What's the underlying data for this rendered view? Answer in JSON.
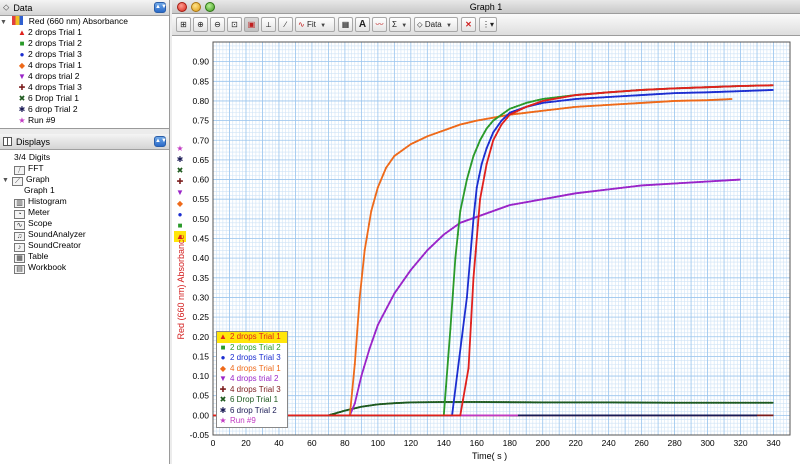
{
  "left_panel": {
    "data_header": "Data",
    "data_root": "Red (660 nm) Absorbance",
    "runs": [
      {
        "label": "2 drops Trial 1",
        "marker": "▲",
        "color": "#e0211d"
      },
      {
        "label": "2 drops Trial 2",
        "marker": "■",
        "color": "#2a9a2a"
      },
      {
        "label": "2 drops Trial 3",
        "marker": "●",
        "color": "#1c2ed0"
      },
      {
        "label": "4 drops Trial 1",
        "marker": "◆",
        "color": "#ee6a1a"
      },
      {
        "label": "4 drops trial 2",
        "marker": "▼",
        "color": "#9a25c8"
      },
      {
        "label": "4 drops Trial 3",
        "marker": "✚",
        "color": "#7a1b1b"
      },
      {
        "label": "6 Drop Trial 1",
        "marker": "✖",
        "color": "#1f5a1f"
      },
      {
        "label": "6 drop Trial 2",
        "marker": "✱",
        "color": "#1a1a55"
      },
      {
        "label": "Run #9",
        "marker": "★",
        "color": "#c23ac2"
      }
    ],
    "displays_header": "Displays",
    "display_items": [
      {
        "label": "Digits",
        "icon": "digits-icon",
        "glyph": "3/4",
        "indent": 0
      },
      {
        "label": "FFT",
        "icon": "fft-icon",
        "glyph": "",
        "indent": 0
      },
      {
        "label": "Graph",
        "icon": "graph-icon",
        "glyph": "",
        "indent": 0
      },
      {
        "label": "Graph 1",
        "icon": "",
        "glyph": "",
        "indent": 1
      },
      {
        "label": "Histogram",
        "icon": "histogram-icon",
        "glyph": "",
        "indent": 0
      },
      {
        "label": "Meter",
        "icon": "meter-icon",
        "glyph": "",
        "indent": 0
      },
      {
        "label": "Scope",
        "icon": "scope-icon",
        "glyph": "",
        "indent": 0
      },
      {
        "label": "SoundAnalyzer",
        "icon": "sound-analyzer-icon",
        "glyph": "",
        "indent": 0
      },
      {
        "label": "SoundCreator",
        "icon": "sound-creator-icon",
        "glyph": "",
        "indent": 0
      },
      {
        "label": "Table",
        "icon": "table-icon",
        "glyph": "",
        "indent": 0
      },
      {
        "label": "Workbook",
        "icon": "workbook-icon",
        "glyph": "",
        "indent": 0
      }
    ]
  },
  "window": {
    "title": "Graph 1",
    "toolbar": {
      "fit_label": "Fit",
      "data_label": "Data",
      "sigma_label": "Σ",
      "letter_a": "A"
    }
  },
  "chart_data": {
    "type": "line",
    "title": "",
    "xlabel": "Time( s )",
    "ylabel": "Red (660 nm) Absorbance",
    "xlim": [
      0,
      350
    ],
    "ylim": [
      -0.05,
      0.95
    ],
    "x_ticks": [
      0,
      10,
      20,
      30,
      40,
      50,
      60,
      70,
      80,
      90,
      100,
      110,
      120,
      130,
      140,
      150,
      160,
      170,
      180,
      190,
      200,
      210,
      220,
      230,
      240,
      250,
      260,
      270,
      280,
      290,
      300,
      310,
      320,
      330,
      340
    ],
    "y_ticks": [
      -0.05,
      0.0,
      0.05,
      0.1,
      0.15,
      0.2,
      0.25,
      0.3,
      0.35,
      0.4,
      0.45,
      0.5,
      0.55,
      0.6,
      0.65,
      0.7,
      0.75,
      0.8,
      0.85,
      0.9
    ],
    "grid": true,
    "legend_position": "bottom-left",
    "series": [
      {
        "name": "2 drops Trial 1",
        "color": "#e0211d",
        "marker": "▲",
        "x": [
          0,
          150,
          155,
          158,
          162,
          166,
          170,
          175,
          180,
          190,
          200,
          220,
          240,
          260,
          280,
          300,
          320,
          340
        ],
        "y": [
          0,
          0,
          0.12,
          0.35,
          0.55,
          0.64,
          0.7,
          0.74,
          0.765,
          0.785,
          0.8,
          0.815,
          0.822,
          0.828,
          0.832,
          0.835,
          0.838,
          0.84
        ]
      },
      {
        "name": "2 drops Trial 2",
        "color": "#2a9a2a",
        "marker": "■",
        "x": [
          0,
          140,
          144,
          147,
          150,
          154,
          158,
          162,
          166,
          170,
          175,
          180,
          190,
          200,
          220,
          240,
          260,
          280,
          300,
          320,
          340
        ],
        "y": [
          0,
          0,
          0.22,
          0.4,
          0.52,
          0.6,
          0.66,
          0.7,
          0.73,
          0.75,
          0.765,
          0.78,
          0.795,
          0.805,
          0.815,
          0.822,
          0.828,
          0.832,
          0.835,
          0.838,
          0.84
        ]
      },
      {
        "name": "2 drops Trial 3",
        "color": "#1c2ed0",
        "marker": "●",
        "x": [
          0,
          145,
          148,
          151,
          154,
          156,
          158,
          160,
          163,
          166,
          170,
          175,
          180,
          190,
          200,
          220,
          240,
          260,
          280,
          300,
          320,
          340
        ],
        "y": [
          0,
          0,
          0.1,
          0.2,
          0.3,
          0.4,
          0.5,
          0.58,
          0.64,
          0.68,
          0.72,
          0.75,
          0.77,
          0.785,
          0.795,
          0.805,
          0.81,
          0.815,
          0.82,
          0.822,
          0.825,
          0.828
        ]
      },
      {
        "name": "4 drops Trial 1",
        "color": "#ee6a1a",
        "marker": "◆",
        "x": [
          0,
          83,
          86,
          89,
          92,
          96,
          100,
          105,
          110,
          120,
          130,
          140,
          150,
          160,
          180,
          200,
          220,
          240,
          260,
          280,
          300,
          315
        ],
        "y": [
          0,
          0,
          0.13,
          0.3,
          0.42,
          0.52,
          0.58,
          0.63,
          0.66,
          0.69,
          0.71,
          0.725,
          0.74,
          0.75,
          0.765,
          0.775,
          0.785,
          0.79,
          0.795,
          0.8,
          0.802,
          0.805
        ]
      },
      {
        "name": "4 drops trial 2",
        "color": "#9a25c8",
        "marker": "▼",
        "x": [
          0,
          83,
          86,
          90,
          95,
          100,
          110,
          120,
          130,
          140,
          150,
          160,
          170,
          180,
          200,
          220,
          240,
          260,
          280,
          300,
          320
        ],
        "y": [
          0,
          0,
          0.03,
          0.1,
          0.17,
          0.23,
          0.31,
          0.37,
          0.42,
          0.46,
          0.49,
          0.505,
          0.52,
          0.535,
          0.55,
          0.565,
          0.575,
          0.585,
          0.59,
          0.595,
          0.6
        ]
      },
      {
        "name": "4 drops Trial 3",
        "color": "#7a1b1b",
        "marker": "✚",
        "x": [
          0,
          340
        ],
        "y": [
          0,
          0
        ]
      },
      {
        "name": "6 Drop Trial 1",
        "color": "#1f5a1f",
        "marker": "✖",
        "x": [
          0,
          70,
          80,
          90,
          100,
          110,
          120,
          140,
          160,
          200,
          240,
          280,
          320,
          340
        ],
        "y": [
          0,
          0,
          0.012,
          0.022,
          0.028,
          0.031,
          0.033,
          0.034,
          0.034,
          0.033,
          0.033,
          0.032,
          0.032,
          0.032
        ]
      },
      {
        "name": "6 drop Trial 2",
        "color": "#1a1a55",
        "marker": "✱",
        "x": [
          180,
          330
        ],
        "y": [
          0,
          0
        ]
      },
      {
        "name": "Run #9",
        "color": "#c23ac2",
        "marker": "★",
        "x": [
          120,
          185
        ],
        "y": [
          0,
          0
        ]
      }
    ]
  }
}
